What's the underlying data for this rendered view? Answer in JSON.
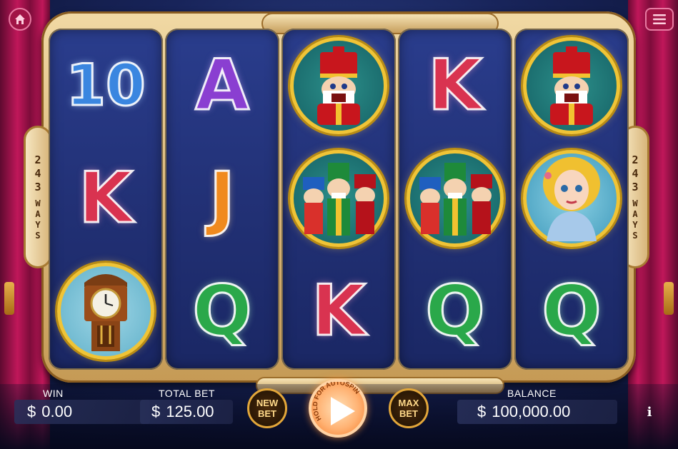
{
  "side_badges": {
    "left": {
      "number": "243",
      "label": "WAYS"
    },
    "right": {
      "number": "243",
      "label": "WAYS"
    }
  },
  "reels": [
    [
      {
        "kind": "letter",
        "symbol": "10",
        "color": "blue",
        "icon": "candy-cane-10-icon"
      },
      {
        "kind": "letter",
        "symbol": "K",
        "color": "pink",
        "icon": "candy-cane-k-icon"
      },
      {
        "kind": "picture",
        "symbol": "grandfather-clock",
        "icon": "grandfather-clock-icon"
      }
    ],
    [
      {
        "kind": "letter",
        "symbol": "A",
        "color": "purple",
        "icon": "candy-cane-a-icon"
      },
      {
        "kind": "letter",
        "symbol": "J",
        "color": "orange",
        "icon": "candy-cane-j-icon"
      },
      {
        "kind": "letter",
        "symbol": "Q",
        "color": "green",
        "icon": "candy-cane-q-icon"
      }
    ],
    [
      {
        "kind": "picture",
        "symbol": "nutcracker",
        "icon": "nutcracker-icon"
      },
      {
        "kind": "picture",
        "symbol": "nutcracker-trio",
        "icon": "nutcracker-soldiers-icon"
      },
      {
        "kind": "letter",
        "symbol": "K",
        "color": "pink",
        "icon": "candy-cane-k-icon"
      }
    ],
    [
      {
        "kind": "letter",
        "symbol": "K",
        "color": "pink",
        "icon": "candy-cane-k-icon"
      },
      {
        "kind": "picture",
        "symbol": "nutcracker-trio",
        "icon": "nutcracker-soldiers-icon"
      },
      {
        "kind": "letter",
        "symbol": "Q",
        "color": "green",
        "icon": "candy-cane-q-icon"
      }
    ],
    [
      {
        "kind": "picture",
        "symbol": "nutcracker",
        "icon": "nutcracker-icon"
      },
      {
        "kind": "picture",
        "symbol": "clara-girl",
        "icon": "girl-portrait-icon"
      },
      {
        "kind": "letter",
        "symbol": "Q",
        "color": "green",
        "icon": "candy-cane-q-icon"
      }
    ]
  ],
  "bottom": {
    "win_label": "WIN",
    "win_currency": "$",
    "win_value": "0.00",
    "total_bet_label": "TOTAL BET",
    "total_bet_currency": "$",
    "total_bet_value": "125.00",
    "new_bet_line1": "NEW",
    "new_bet_line2": "BET",
    "spin_hint": "HOLD FOR AUTOSPIN",
    "max_bet_line1": "MAX",
    "max_bet_line2": "BET",
    "balance_label": "BALANCE",
    "balance_currency": "$",
    "balance_value": "100,000.00",
    "info_label": "i"
  },
  "colors": {
    "curtain": "#c0175a",
    "frame_gold": "#e3a73a",
    "reel_bg": "#223176",
    "spin_orange": "#f57c2a"
  }
}
